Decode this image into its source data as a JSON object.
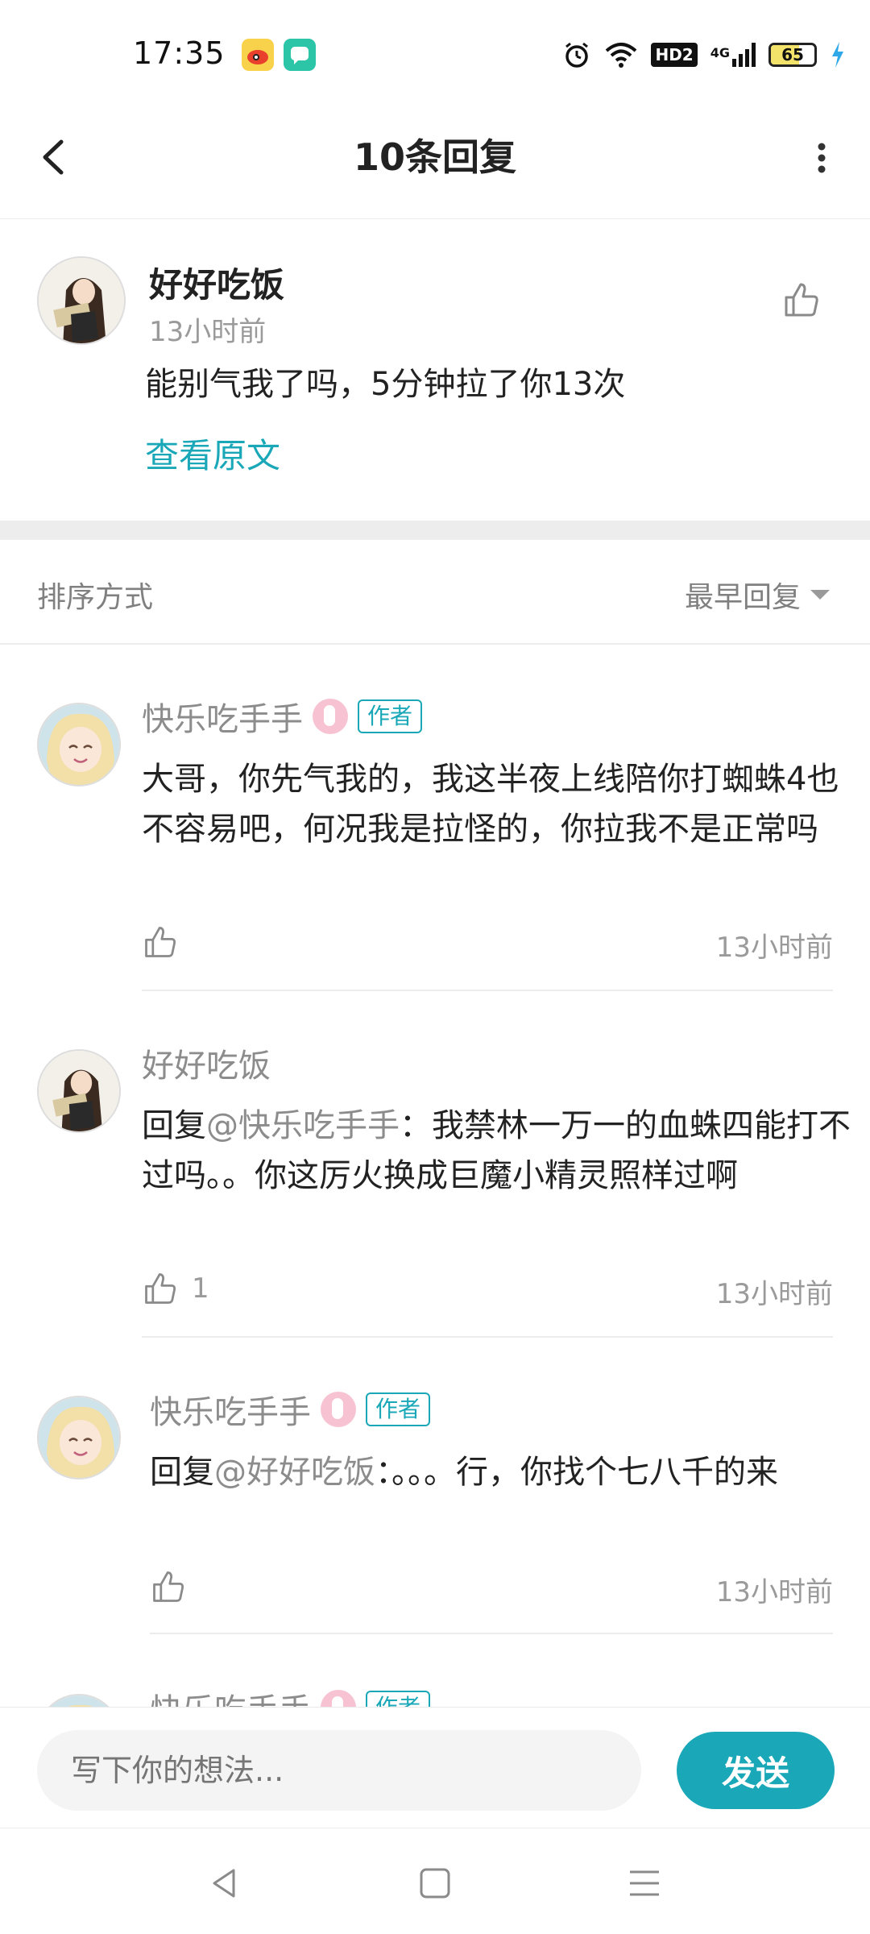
{
  "status_bar": {
    "time": "17:35",
    "hd_label": "HD2",
    "network_label": "4G",
    "battery_level": "65",
    "icons": [
      "weibo-icon",
      "message-app-icon",
      "alarm-icon",
      "wifi-icon",
      "hd-icon",
      "signal-icon",
      "battery-icon",
      "charging-icon"
    ]
  },
  "header": {
    "title": "10条回复"
  },
  "original_comment": {
    "user": "好好吃饭",
    "time": "13小时前",
    "text": "能别气我了吗，5分钟拉了你13次",
    "view_original": "查看原文"
  },
  "sort_bar": {
    "label": "排序方式",
    "selected": "最早回复"
  },
  "replies": [
    {
      "user": "快乐吃手手",
      "tag": "作者",
      "text": "大哥，你先气我的，我这半夜上线陪你打蜘蛛4也不容易吧，何况我是拉怪的，你拉我不是正常吗",
      "likes": "",
      "time": "13小时前"
    },
    {
      "user": "好好吃饭",
      "tag": "",
      "reply_prefix": "回复",
      "mention": "@快乐吃手手",
      "text": "：我禁林一万一的血蛛四能打不过吗。。你这厉火换成巨魔小精灵照样过啊",
      "likes": "1",
      "time": "13小时前"
    },
    {
      "user": "快乐吃手手",
      "tag": "作者",
      "reply_prefix": "回复",
      "mention": "@好好吃饭",
      "text": "：。。。行，你找个七八千的来",
      "likes": "",
      "time": "13小时前"
    },
    {
      "user": "快乐吃手手",
      "tag": "作者"
    }
  ],
  "input_bar": {
    "placeholder": "写下你的想法...",
    "send_label": "发送"
  },
  "colors": {
    "accent": "#1aa8b8",
    "muted": "#9a9a9a"
  }
}
